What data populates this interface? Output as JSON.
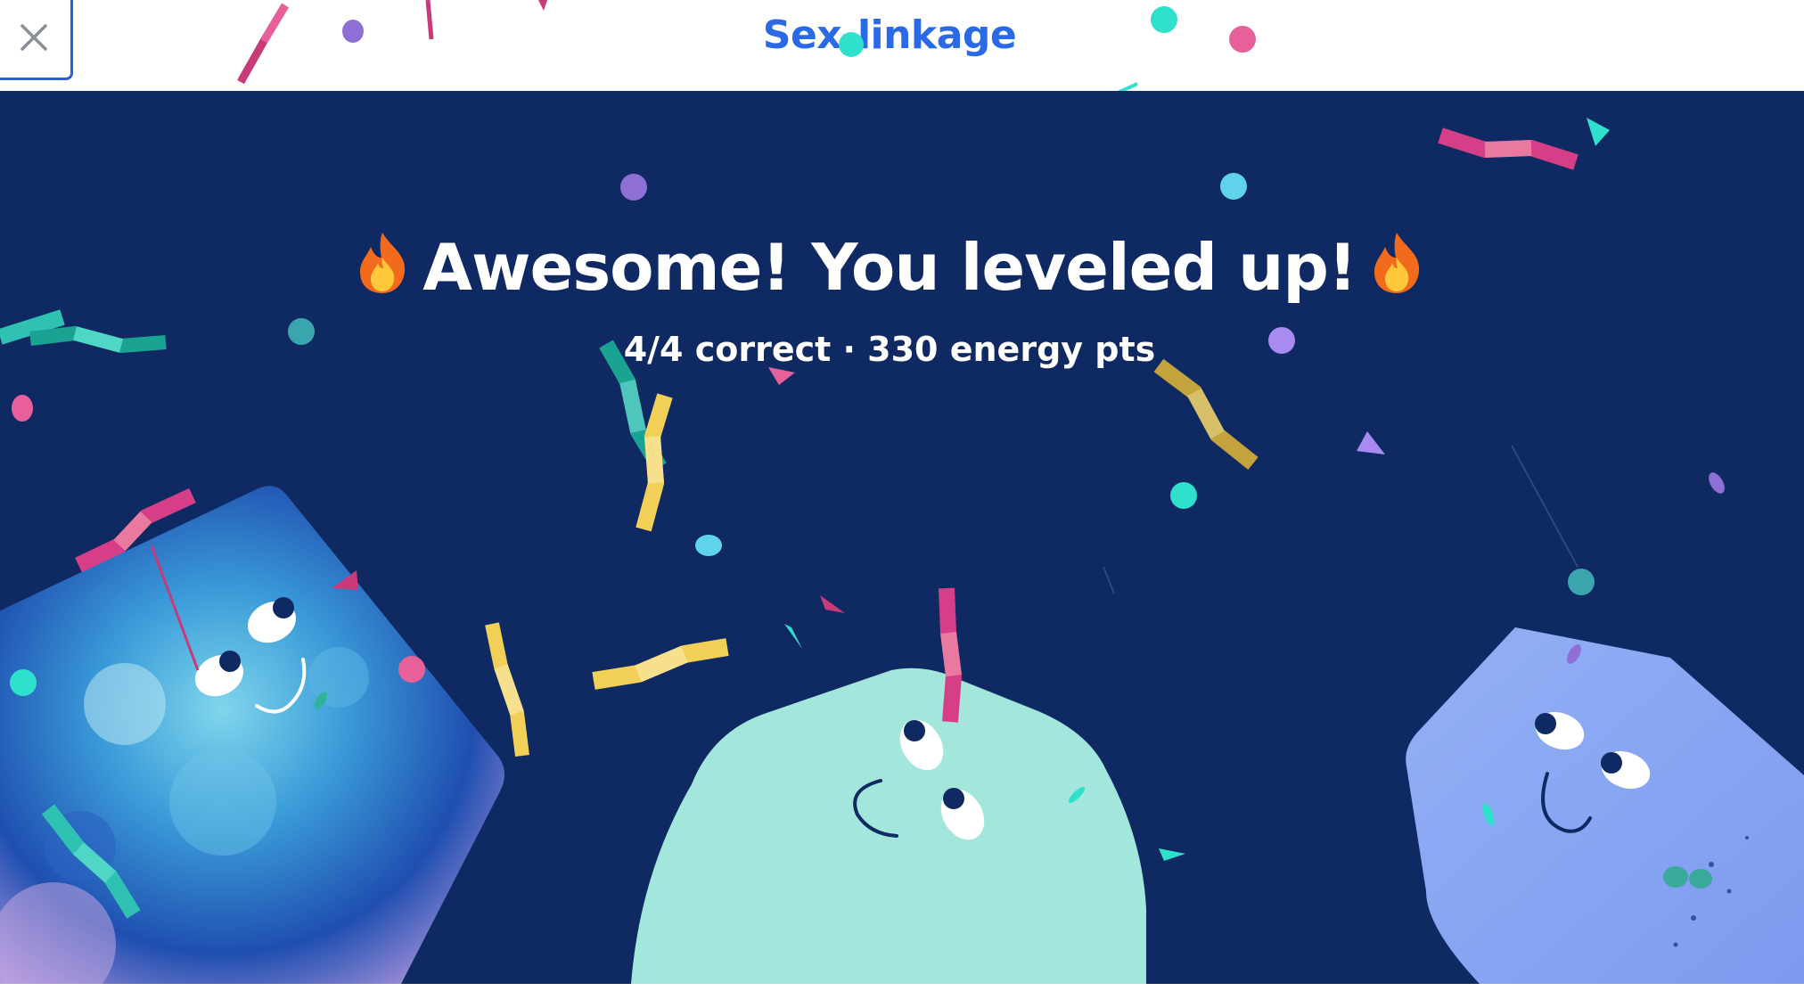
{
  "header": {
    "app_title": "Sex-linkage",
    "close_icon": "close-icon"
  },
  "celebration": {
    "headline": "Awesome! You leveled up!",
    "headline_icon": "fire-icon",
    "stats": "4/4 correct · 330 energy pts"
  },
  "characters": [
    {
      "name": "blue-galaxy-blob",
      "color": "#2e6fcf"
    },
    {
      "name": "mint-blob",
      "color": "#a3e6dc"
    },
    {
      "name": "periwinkle-blob",
      "color": "#88a6f2"
    }
  ],
  "colors": {
    "background": "#0f2a63",
    "accent": "#2b6ae6",
    "confetti": [
      "#2fe0cc",
      "#e8609a",
      "#f2cf56",
      "#8f6fd6",
      "#c83a7a",
      "#4fc6e6"
    ]
  }
}
